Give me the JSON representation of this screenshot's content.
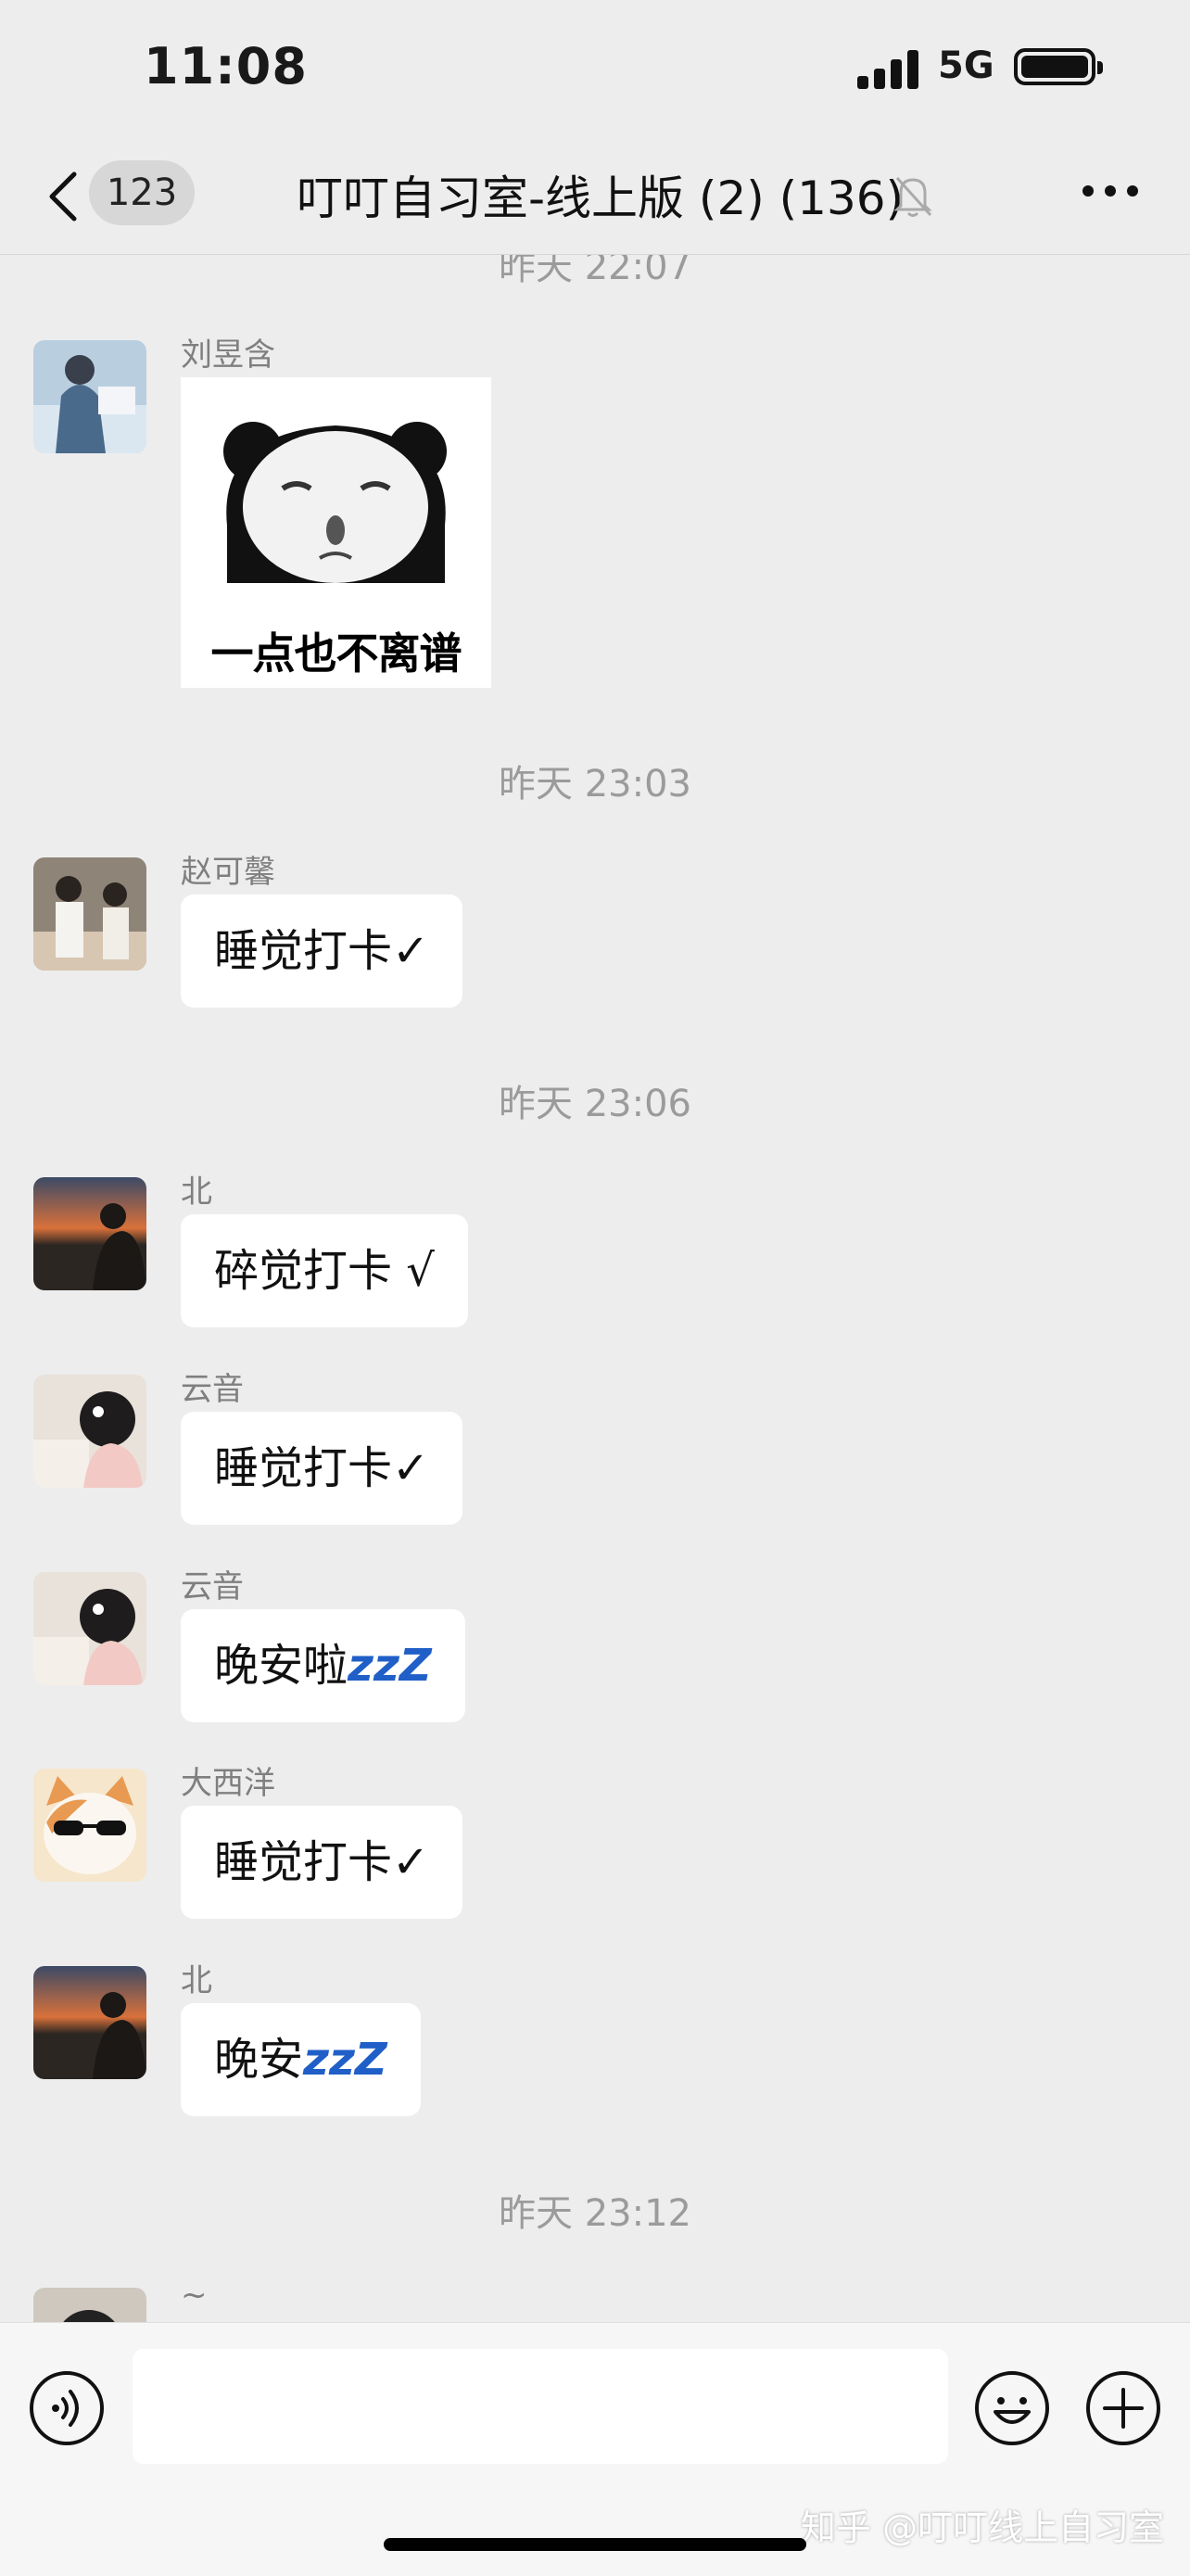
{
  "status_bar": {
    "time": "11:08",
    "network": "5G"
  },
  "nav": {
    "back_badge": "123",
    "title": "叮叮自习室-线上版 (2) (136)"
  },
  "chat": {
    "timestamps": [
      "昨天 22:07",
      "昨天 23:03",
      "昨天 23:06",
      "昨天 23:12"
    ],
    "messages": [
      {
        "sender": "刘昱含",
        "sticker_caption": "一点也不离谱"
      },
      {
        "sender": "赵可馨",
        "text": "睡觉打卡✓"
      },
      {
        "sender": "北",
        "text": "碎觉打卡 √"
      },
      {
        "sender": "云音",
        "text": "睡觉打卡✓"
      },
      {
        "sender": "云音",
        "text": "晚安啦"
      },
      {
        "sender": "大西洋",
        "text": "睡觉打卡✓"
      },
      {
        "sender": "北",
        "text": "晚安"
      },
      {
        "sender": "~"
      }
    ],
    "zzz": "zzZ"
  },
  "input_bar": {
    "watermark": "知乎 @叮叮线上自习室"
  },
  "icons": {
    "back": "chevron-left-icon",
    "mute": "bell-slash-icon",
    "more": "more-dots-icon",
    "voice": "voice-icon",
    "emoji": "emoji-icon",
    "plus": "plus-icon"
  },
  "colors": {
    "background": "#ededed",
    "bubble": "#ffffff",
    "zzz": "#1f5fc7"
  }
}
